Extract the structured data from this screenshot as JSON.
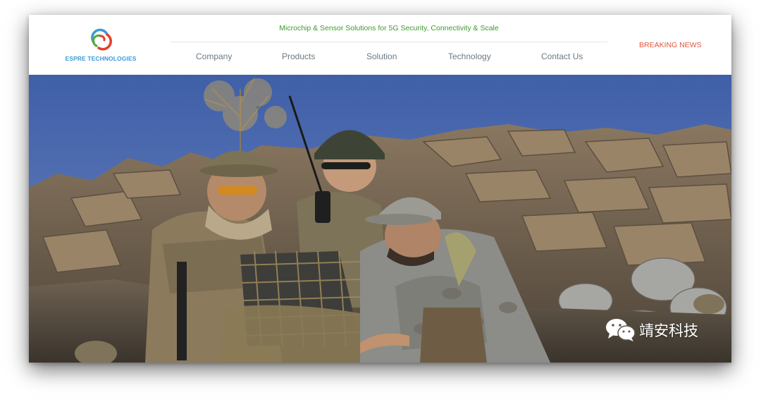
{
  "brand": {
    "name": "ESPRE TECHNOLOGIES",
    "logo_icon": "swirl-logo-icon",
    "colors": {
      "red": "#e2412d",
      "blue": "#3c9bd6",
      "green": "#5aaa3a"
    }
  },
  "header": {
    "tagline": "Microchip & Sensor Solutions for 5G Security, Connectivity & Scale",
    "tagline_color": "#3c9a2b",
    "breaking_news": "BREAKING NEWS",
    "breaking_color": "#e0553e"
  },
  "nav": {
    "items": [
      {
        "label": "Company"
      },
      {
        "label": "Products"
      },
      {
        "label": "Solution"
      },
      {
        "label": "Technology"
      },
      {
        "label": "Contact Us"
      }
    ],
    "text_color": "#6b7a83"
  },
  "hero": {
    "image": "soldiers-with-radio-and-laptop-in-rocky-terrain"
  },
  "watermark": {
    "icon": "wechat-icon",
    "text": "靖安科技"
  }
}
